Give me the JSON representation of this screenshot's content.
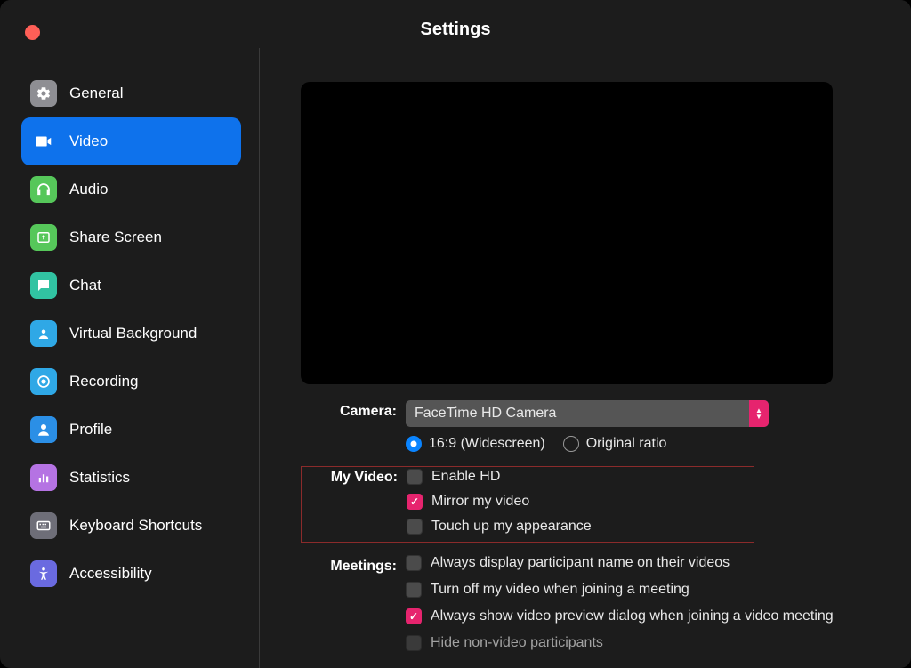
{
  "window": {
    "title": "Settings"
  },
  "sidebar": {
    "items": [
      {
        "key": "general",
        "label": "General",
        "icon_color": "#8e8e93"
      },
      {
        "key": "video",
        "label": "Video",
        "icon_color": "#ffffff",
        "active": true
      },
      {
        "key": "audio",
        "label": "Audio",
        "icon_color": "#56c75a"
      },
      {
        "key": "share-screen",
        "label": "Share Screen",
        "icon_color": "#56c75a"
      },
      {
        "key": "chat",
        "label": "Chat",
        "icon_color": "#31c3a2"
      },
      {
        "key": "virtual-background",
        "label": "Virtual Background",
        "icon_color": "#2fa8e6"
      },
      {
        "key": "recording",
        "label": "Recording",
        "icon_color": "#2fa8e6"
      },
      {
        "key": "profile",
        "label": "Profile",
        "icon_color": "#2b8fe6"
      },
      {
        "key": "statistics",
        "label": "Statistics",
        "icon_color": "#b573e3"
      },
      {
        "key": "keyboard-shortcuts",
        "label": "Keyboard Shortcuts",
        "icon_color": "#6e6e78"
      },
      {
        "key": "accessibility",
        "label": "Accessibility",
        "icon_color": "#6a6ae0"
      }
    ]
  },
  "content": {
    "camera": {
      "label": "Camera:",
      "selected": "FaceTime HD Camera",
      "ratio_options": [
        {
          "key": "wide",
          "label": "16:9 (Widescreen)",
          "selected": true
        },
        {
          "key": "original",
          "label": " Original ratio",
          "selected": false
        }
      ]
    },
    "my_video": {
      "label": "My Video:",
      "options": [
        {
          "key": "enable-hd",
          "label": "Enable HD",
          "checked": false
        },
        {
          "key": "mirror",
          "label": "Mirror my video",
          "checked": true
        },
        {
          "key": "touchup",
          "label": "Touch up my appearance",
          "checked": false
        }
      ]
    },
    "meetings": {
      "label": "Meetings:",
      "options": [
        {
          "key": "always-display-name",
          "label": "Always display participant name on their videos",
          "checked": false
        },
        {
          "key": "turn-off-video",
          "label": "Turn off my video when joining a meeting",
          "checked": false
        },
        {
          "key": "show-preview",
          "label": "Always show video preview dialog when joining a video meeting",
          "checked": true
        },
        {
          "key": "hide-nonvideo",
          "label": "Hide non-video participants",
          "checked": false
        }
      ]
    }
  }
}
